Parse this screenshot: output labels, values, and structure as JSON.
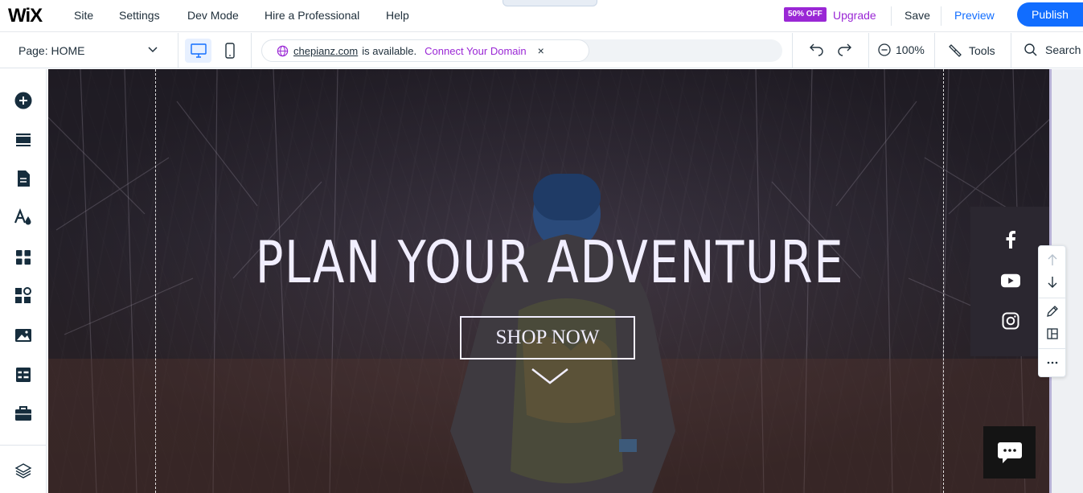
{
  "topbar": {
    "logo": "WiX",
    "menu": [
      "Site",
      "Settings",
      "Dev Mode",
      "Hire a Professional",
      "Help"
    ],
    "tab_notch": "×",
    "promo_badge": "50% OFF",
    "upgrade": "Upgrade",
    "save": "Save",
    "preview": "Preview",
    "publish": "Publish"
  },
  "toolbar": {
    "page_select": "Page: HOME",
    "domain_name": "chepianz.com",
    "domain_available": "is available.",
    "connect_domain": "Connect Your Domain",
    "close": "×",
    "zoom": "100%",
    "tools": "Tools",
    "search": "Search"
  },
  "hero": {
    "title": "PLAN YOUR ADVENTURE",
    "button": "SHOP NOW"
  },
  "icons": {
    "sidebar": [
      "add-icon",
      "sections-icon",
      "pages-icon",
      "theme-icon",
      "apps-icon",
      "extensions-icon",
      "media-icon",
      "cms-icon",
      "business-icon",
      "layers-icon"
    ],
    "social": [
      "facebook-icon",
      "youtube-icon",
      "instagram-icon"
    ]
  },
  "colors": {
    "accent": "#116dff",
    "promo": "#9a27d5",
    "hero_text": "#f1eeff"
  }
}
